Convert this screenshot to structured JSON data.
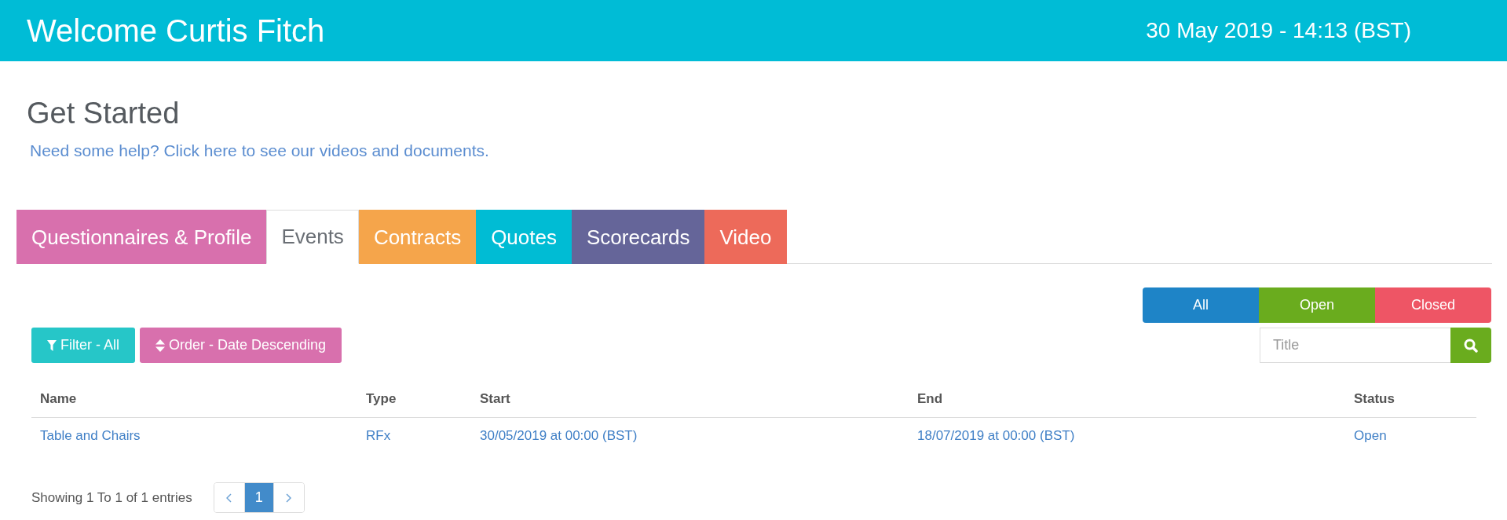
{
  "header": {
    "title": "Welcome Curtis Fitch",
    "datetime": "30 May 2019 - 14:13 (BST)"
  },
  "intro": {
    "heading": "Get Started",
    "help_link": "Need some help? Click here to see our videos and documents."
  },
  "tabs": [
    {
      "label": "Questionnaires & Profile",
      "selected": false,
      "color": "#d870ad"
    },
    {
      "label": "Events",
      "selected": true
    },
    {
      "label": "Contracts",
      "selected": false,
      "color": "#f5a54b"
    },
    {
      "label": "Quotes",
      "selected": false,
      "color": "#00bcd4"
    },
    {
      "label": "Scorecards",
      "selected": false,
      "color": "#656599"
    },
    {
      "label": "Video",
      "selected": false,
      "color": "#ed6a5a"
    }
  ],
  "status_filters": [
    {
      "label": "All",
      "color": "#1e84c7"
    },
    {
      "label": "Open",
      "color": "#6aac1e"
    },
    {
      "label": "Closed",
      "color": "#ee5565"
    }
  ],
  "toolbar": {
    "filter_button": "Filter - All",
    "order_button": "Order - Date Descending"
  },
  "search": {
    "placeholder": "Title"
  },
  "table": {
    "columns": [
      "Name",
      "Type",
      "Start",
      "End",
      "Status"
    ],
    "rows": [
      [
        "Table and Chairs",
        "RFx",
        "30/05/2019 at 00:00 (BST)",
        "18/07/2019 at 00:00 (BST)",
        "Open"
      ]
    ]
  },
  "pagination": {
    "summary": "Showing 1 To 1 of 1 entries",
    "pages": [
      {
        "label": "1",
        "selected": true
      }
    ]
  }
}
